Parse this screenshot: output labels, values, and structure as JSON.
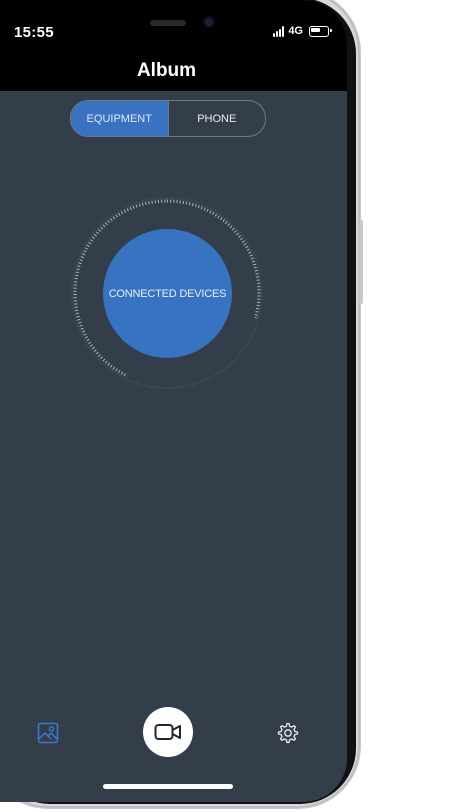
{
  "status_bar": {
    "time": "15:55",
    "network": "4G"
  },
  "header": {
    "title": "Album"
  },
  "segment": {
    "items": [
      {
        "label": "EQUIPMENT",
        "active": true
      },
      {
        "label": "PHONE",
        "active": false
      }
    ]
  },
  "main": {
    "connect_label": "CONNECTED DEVICES"
  },
  "tabbar": {
    "album_icon": "image-icon",
    "record_icon": "video-camera-icon",
    "settings_icon": "gear-icon"
  },
  "colors": {
    "background": "#343e4b",
    "accent": "#3873c1",
    "topbar": "#000000"
  }
}
